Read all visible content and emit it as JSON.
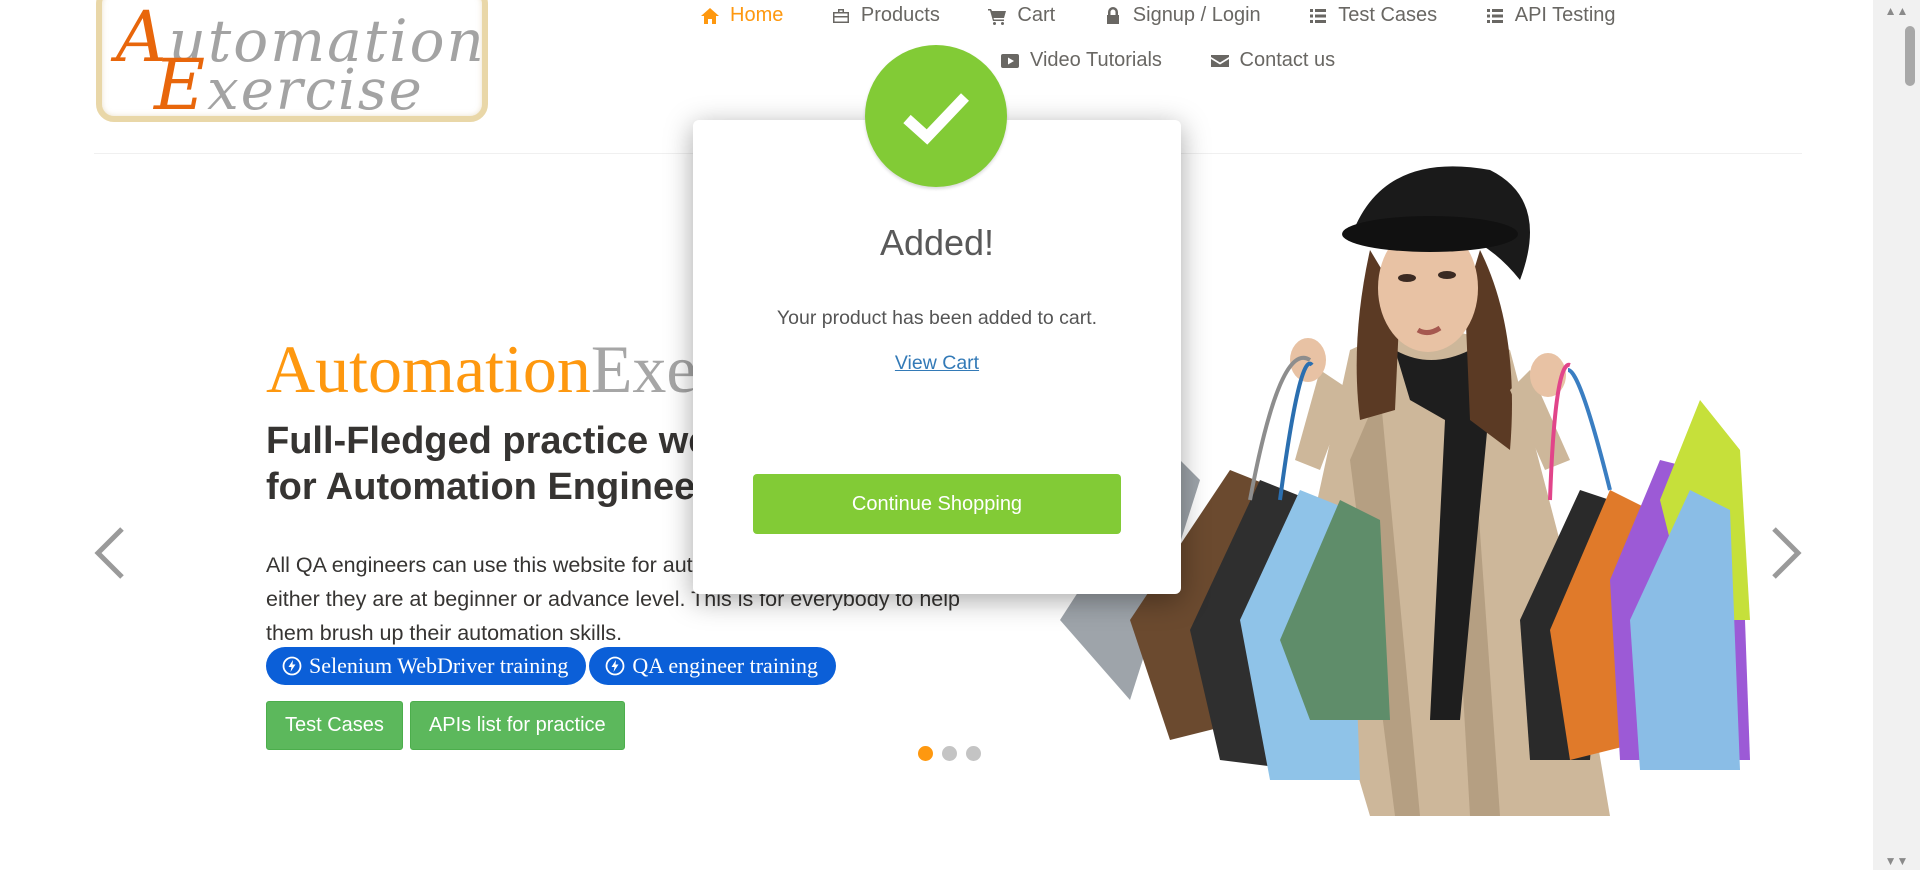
{
  "logo": {
    "line1_cap": "A",
    "line1_rest": "utomation",
    "line2_cap": "E",
    "line2_rest": "xercise"
  },
  "nav": {
    "items": [
      {
        "label": "Home",
        "icon": "home-icon",
        "active": true
      },
      {
        "label": "Products",
        "icon": "briefcase-icon"
      },
      {
        "label": "Cart",
        "icon": "cart-icon"
      },
      {
        "label": "Signup / Login",
        "icon": "lock-icon"
      },
      {
        "label": "Test Cases",
        "icon": "list-icon"
      },
      {
        "label": "API Testing",
        "icon": "list-icon"
      },
      {
        "label": "Video Tutorials",
        "icon": "youtube-icon"
      },
      {
        "label": "Contact us",
        "icon": "envelope-icon"
      }
    ]
  },
  "slider": {
    "title_part1": "Automation",
    "title_part2": "Exercise",
    "subtitle": "Full-Fledged practice website for Automation Engineers",
    "description": "All QA engineers can use this website for automation practice and API testing either they are at beginner or advance level. This is for everybody to help them brush up their automation skills.",
    "pill1": "Selenium WebDriver training",
    "pill2": "QA engineer training",
    "btn_test_cases": "Test Cases",
    "btn_apis": "APIs list for practice",
    "active_slide": 1,
    "slide_count": 3
  },
  "modal": {
    "title": "Added!",
    "message": "Your product has been added to cart.",
    "view_cart": "View Cart",
    "continue": "Continue Shopping"
  },
  "colors": {
    "accent_orange": "#fe980f",
    "success_green": "#82cb36",
    "button_green": "#5cb85c",
    "pill_blue": "#0b5fd8",
    "link_blue": "#337ab7"
  }
}
